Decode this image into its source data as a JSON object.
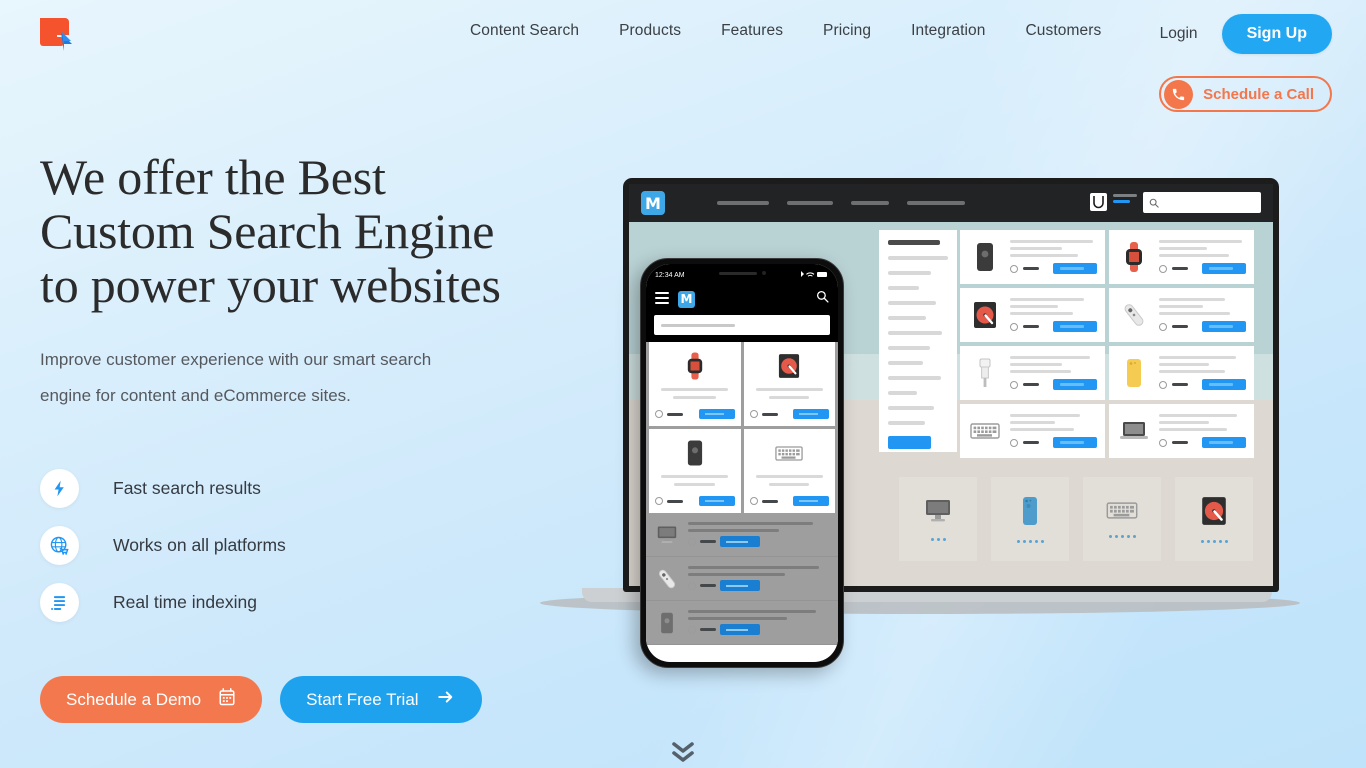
{
  "brand": {
    "logo_icon": "expertrec-logo-icon",
    "accent_orange": "#f4764b",
    "accent_blue": "#22a8f2",
    "background": "#cfe9fb"
  },
  "nav": {
    "links": [
      {
        "label": "Content Search"
      },
      {
        "label": "Products"
      },
      {
        "label": "Features"
      },
      {
        "label": "Pricing"
      },
      {
        "label": "Integration"
      },
      {
        "label": "Customers"
      }
    ],
    "login_label": "Login",
    "signup_label": "Sign Up"
  },
  "call_pill": {
    "label": "Schedule a Call",
    "icon": "phone-icon"
  },
  "hero": {
    "headline_line1": "We offer the Best",
    "headline_line2": "Custom Search Engine",
    "headline_line3": "to power your websites",
    "subtitle_line1": "Improve customer experience with our smart search",
    "subtitle_line2": "engine for content and eCommerce sites.",
    "features": [
      {
        "label": "Fast search results",
        "icon": "lightning-bolt-icon"
      },
      {
        "label": "Works on all platforms",
        "icon": "globe-cart-icon"
      },
      {
        "label": "Real time indexing",
        "icon": "index-list-icon"
      }
    ],
    "cta_primary": {
      "label": "Schedule a Demo",
      "icon": "calendar-icon"
    },
    "cta_secondary": {
      "label": "Start Free Trial",
      "icon": "arrow-right-icon"
    }
  },
  "scroll_hint": {
    "icon": "double-chevron-down-icon"
  },
  "mockup": {
    "laptop": {
      "store_logo": "M",
      "search_placeholder": "",
      "nav_item_count": 4,
      "facet_line_count": 13,
      "facet_button": "",
      "products": [
        {
          "icon": "phone-dark-icon"
        },
        {
          "icon": "smartwatch-red-icon"
        },
        {
          "icon": "harddrive-icon"
        },
        {
          "icon": "remote-icon"
        },
        {
          "icon": "usb-cable-icon"
        },
        {
          "icon": "phone-yellow-icon"
        },
        {
          "icon": "keyboard-icon"
        },
        {
          "icon": "laptop-icon"
        }
      ],
      "shelf_tiles": [
        {
          "icon": "monitor-icon"
        },
        {
          "icon": "phone-blue-icon"
        },
        {
          "icon": "keyboard-icon"
        },
        {
          "icon": "harddrive-icon"
        }
      ]
    },
    "phone": {
      "status_time": "12:34 AM",
      "status_icons": "bluetooth-wifi-battery",
      "store_logo": "M",
      "grid_products": [
        {
          "icon": "smartwatch-red-icon"
        },
        {
          "icon": "harddrive-icon"
        },
        {
          "icon": "phone-dark-icon"
        },
        {
          "icon": "keyboard-icon"
        }
      ],
      "list_products": [
        {
          "icon": "monitor-icon"
        },
        {
          "icon": "remote-icon"
        },
        {
          "icon": "phone-dark-icon"
        }
      ]
    }
  }
}
